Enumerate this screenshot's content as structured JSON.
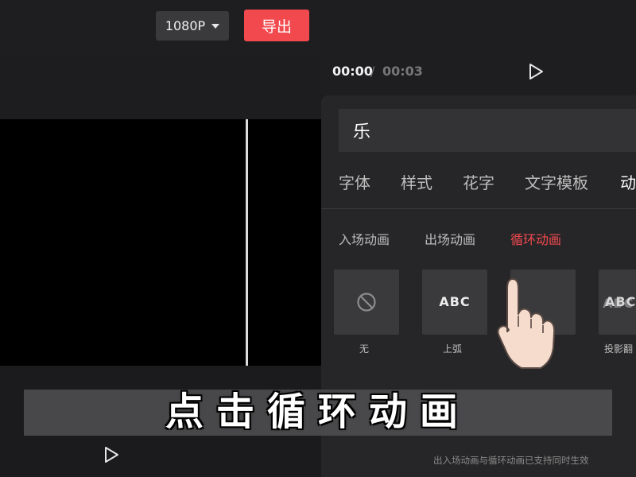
{
  "toolbar": {
    "resolution_label": "1080P",
    "export_label": "导出"
  },
  "playback": {
    "current_time": "00:00",
    "separator": "/",
    "total_time": "00:03"
  },
  "editor": {
    "text_value": "乐",
    "tabs": [
      {
        "label": "字体"
      },
      {
        "label": "样式"
      },
      {
        "label": "花字"
      },
      {
        "label": "文字模板"
      },
      {
        "label": "动"
      }
    ],
    "animation_tabs": [
      {
        "label": "入场动画"
      },
      {
        "label": "出场动画"
      },
      {
        "label": "循环动画",
        "active": true
      }
    ],
    "presets": [
      {
        "label": "无",
        "icon": "ban-icon"
      },
      {
        "label": "上弧",
        "preview": "ABC"
      },
      {
        "label": "",
        "preview": ""
      },
      {
        "label": "投影翻",
        "preview": "ABC"
      }
    ],
    "footnote": "出入场动画与循环动画已支持同时生效"
  },
  "caption": {
    "text": "点击循环动画"
  },
  "colors": {
    "accent": "#f2494f",
    "background": "#1b1b1d",
    "panel": "#262628"
  }
}
